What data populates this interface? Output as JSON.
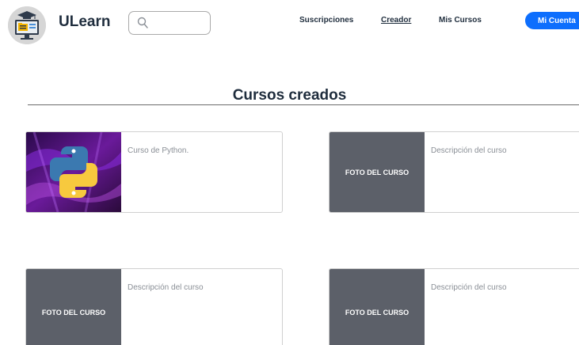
{
  "header": {
    "brand": "ULearn",
    "search": {
      "placeholder": "",
      "value": ""
    },
    "nav": [
      {
        "label": "Suscripciones",
        "active": false
      },
      {
        "label": "Creador",
        "active": true
      },
      {
        "label": "Mis Cursos",
        "active": false
      }
    ],
    "account_button": "Mi Cuenta"
  },
  "main": {
    "title": "Cursos creados",
    "courses": [
      {
        "thumb_label": "",
        "image": "python-logo",
        "description": "Curso de Python."
      },
      {
        "thumb_label": "FOTO DEL CURSO",
        "description": "Descripción del curso"
      },
      {
        "thumb_label": "FOTO DEL CURSO",
        "description": "Descripción del curso"
      },
      {
        "thumb_label": "FOTO DEL CURSO",
        "description": "Descripción del curso"
      }
    ]
  },
  "colors": {
    "primary": "#0d6efd",
    "thumb_placeholder": "#5c6069",
    "text_dark": "#1f2d3d"
  }
}
